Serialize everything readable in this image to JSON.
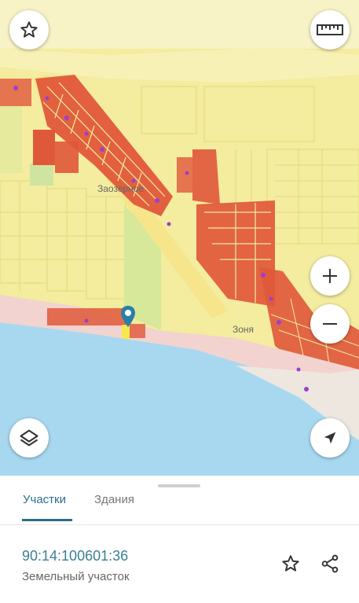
{
  "map": {
    "labels": {
      "settlement_1": "Заозерное",
      "settlement_2": "Зоня"
    },
    "controls": {
      "favorite_icon": "star-outline-icon",
      "ruler_icon": "ruler-icon",
      "zoom_in_icon": "plus-icon",
      "zoom_out_icon": "minus-icon",
      "layers_icon": "layers-icon",
      "locate_icon": "navigation-arrow-icon"
    },
    "marker_icon": "map-pin-icon",
    "colors": {
      "land_yellow": "#f4ec9e",
      "parcel_red": "#e0583a",
      "sea": "#a8d8f0",
      "beach": "#f2d3cf",
      "accent": "#2a6f8a"
    }
  },
  "sheet": {
    "tabs": [
      {
        "label": "Участки",
        "active": true
      },
      {
        "label": "Здания",
        "active": false
      }
    ],
    "cadastral_number": "90:14:100601:36",
    "parcel_type": "Земельный участок",
    "favorite_icon": "star-outline-icon",
    "share_icon": "share-icon"
  }
}
